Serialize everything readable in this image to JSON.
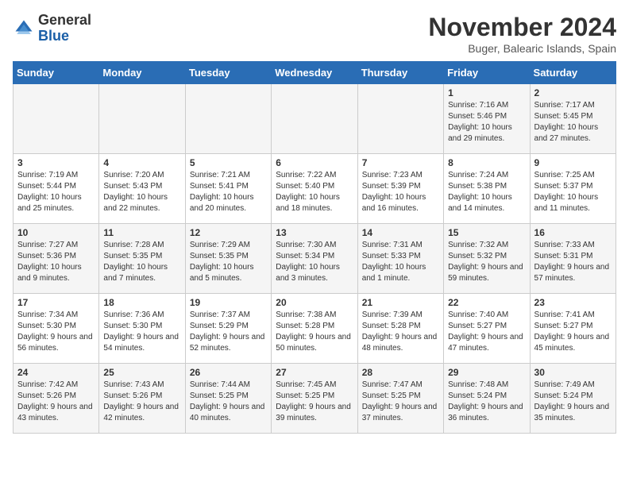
{
  "logo": {
    "general": "General",
    "blue": "Blue"
  },
  "title": {
    "month": "November 2024",
    "location": "Buger, Balearic Islands, Spain"
  },
  "days_of_week": [
    "Sunday",
    "Monday",
    "Tuesday",
    "Wednesday",
    "Thursday",
    "Friday",
    "Saturday"
  ],
  "weeks": [
    [
      {
        "day": null,
        "sunrise": null,
        "sunset": null,
        "daylight": null
      },
      {
        "day": null,
        "sunrise": null,
        "sunset": null,
        "daylight": null
      },
      {
        "day": null,
        "sunrise": null,
        "sunset": null,
        "daylight": null
      },
      {
        "day": null,
        "sunrise": null,
        "sunset": null,
        "daylight": null
      },
      {
        "day": null,
        "sunrise": null,
        "sunset": null,
        "daylight": null
      },
      {
        "day": 1,
        "sunrise": "Sunrise: 7:16 AM",
        "sunset": "Sunset: 5:46 PM",
        "daylight": "Daylight: 10 hours and 29 minutes."
      },
      {
        "day": 2,
        "sunrise": "Sunrise: 7:17 AM",
        "sunset": "Sunset: 5:45 PM",
        "daylight": "Daylight: 10 hours and 27 minutes."
      }
    ],
    [
      {
        "day": 3,
        "sunrise": "Sunrise: 7:19 AM",
        "sunset": "Sunset: 5:44 PM",
        "daylight": "Daylight: 10 hours and 25 minutes."
      },
      {
        "day": 4,
        "sunrise": "Sunrise: 7:20 AM",
        "sunset": "Sunset: 5:43 PM",
        "daylight": "Daylight: 10 hours and 22 minutes."
      },
      {
        "day": 5,
        "sunrise": "Sunrise: 7:21 AM",
        "sunset": "Sunset: 5:41 PM",
        "daylight": "Daylight: 10 hours and 20 minutes."
      },
      {
        "day": 6,
        "sunrise": "Sunrise: 7:22 AM",
        "sunset": "Sunset: 5:40 PM",
        "daylight": "Daylight: 10 hours and 18 minutes."
      },
      {
        "day": 7,
        "sunrise": "Sunrise: 7:23 AM",
        "sunset": "Sunset: 5:39 PM",
        "daylight": "Daylight: 10 hours and 16 minutes."
      },
      {
        "day": 8,
        "sunrise": "Sunrise: 7:24 AM",
        "sunset": "Sunset: 5:38 PM",
        "daylight": "Daylight: 10 hours and 14 minutes."
      },
      {
        "day": 9,
        "sunrise": "Sunrise: 7:25 AM",
        "sunset": "Sunset: 5:37 PM",
        "daylight": "Daylight: 10 hours and 11 minutes."
      }
    ],
    [
      {
        "day": 10,
        "sunrise": "Sunrise: 7:27 AM",
        "sunset": "Sunset: 5:36 PM",
        "daylight": "Daylight: 10 hours and 9 minutes."
      },
      {
        "day": 11,
        "sunrise": "Sunrise: 7:28 AM",
        "sunset": "Sunset: 5:35 PM",
        "daylight": "Daylight: 10 hours and 7 minutes."
      },
      {
        "day": 12,
        "sunrise": "Sunrise: 7:29 AM",
        "sunset": "Sunset: 5:35 PM",
        "daylight": "Daylight: 10 hours and 5 minutes."
      },
      {
        "day": 13,
        "sunrise": "Sunrise: 7:30 AM",
        "sunset": "Sunset: 5:34 PM",
        "daylight": "Daylight: 10 hours and 3 minutes."
      },
      {
        "day": 14,
        "sunrise": "Sunrise: 7:31 AM",
        "sunset": "Sunset: 5:33 PM",
        "daylight": "Daylight: 10 hours and 1 minute."
      },
      {
        "day": 15,
        "sunrise": "Sunrise: 7:32 AM",
        "sunset": "Sunset: 5:32 PM",
        "daylight": "Daylight: 9 hours and 59 minutes."
      },
      {
        "day": 16,
        "sunrise": "Sunrise: 7:33 AM",
        "sunset": "Sunset: 5:31 PM",
        "daylight": "Daylight: 9 hours and 57 minutes."
      }
    ],
    [
      {
        "day": 17,
        "sunrise": "Sunrise: 7:34 AM",
        "sunset": "Sunset: 5:30 PM",
        "daylight": "Daylight: 9 hours and 56 minutes."
      },
      {
        "day": 18,
        "sunrise": "Sunrise: 7:36 AM",
        "sunset": "Sunset: 5:30 PM",
        "daylight": "Daylight: 9 hours and 54 minutes."
      },
      {
        "day": 19,
        "sunrise": "Sunrise: 7:37 AM",
        "sunset": "Sunset: 5:29 PM",
        "daylight": "Daylight: 9 hours and 52 minutes."
      },
      {
        "day": 20,
        "sunrise": "Sunrise: 7:38 AM",
        "sunset": "Sunset: 5:28 PM",
        "daylight": "Daylight: 9 hours and 50 minutes."
      },
      {
        "day": 21,
        "sunrise": "Sunrise: 7:39 AM",
        "sunset": "Sunset: 5:28 PM",
        "daylight": "Daylight: 9 hours and 48 minutes."
      },
      {
        "day": 22,
        "sunrise": "Sunrise: 7:40 AM",
        "sunset": "Sunset: 5:27 PM",
        "daylight": "Daylight: 9 hours and 47 minutes."
      },
      {
        "day": 23,
        "sunrise": "Sunrise: 7:41 AM",
        "sunset": "Sunset: 5:27 PM",
        "daylight": "Daylight: 9 hours and 45 minutes."
      }
    ],
    [
      {
        "day": 24,
        "sunrise": "Sunrise: 7:42 AM",
        "sunset": "Sunset: 5:26 PM",
        "daylight": "Daylight: 9 hours and 43 minutes."
      },
      {
        "day": 25,
        "sunrise": "Sunrise: 7:43 AM",
        "sunset": "Sunset: 5:26 PM",
        "daylight": "Daylight: 9 hours and 42 minutes."
      },
      {
        "day": 26,
        "sunrise": "Sunrise: 7:44 AM",
        "sunset": "Sunset: 5:25 PM",
        "daylight": "Daylight: 9 hours and 40 minutes."
      },
      {
        "day": 27,
        "sunrise": "Sunrise: 7:45 AM",
        "sunset": "Sunset: 5:25 PM",
        "daylight": "Daylight: 9 hours and 39 minutes."
      },
      {
        "day": 28,
        "sunrise": "Sunrise: 7:47 AM",
        "sunset": "Sunset: 5:25 PM",
        "daylight": "Daylight: 9 hours and 37 minutes."
      },
      {
        "day": 29,
        "sunrise": "Sunrise: 7:48 AM",
        "sunset": "Sunset: 5:24 PM",
        "daylight": "Daylight: 9 hours and 36 minutes."
      },
      {
        "day": 30,
        "sunrise": "Sunrise: 7:49 AM",
        "sunset": "Sunset: 5:24 PM",
        "daylight": "Daylight: 9 hours and 35 minutes."
      }
    ]
  ]
}
